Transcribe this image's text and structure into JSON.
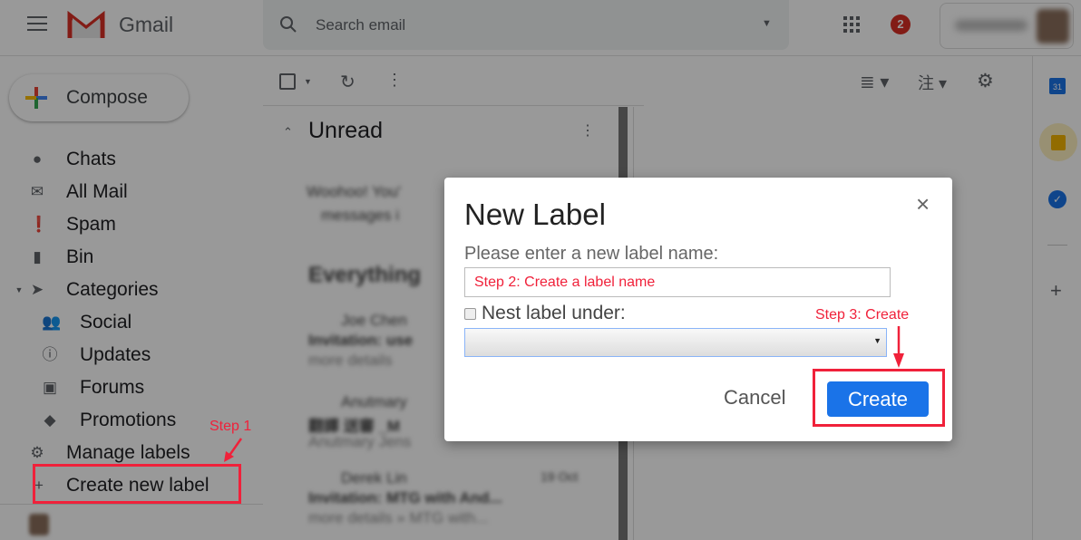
{
  "header": {
    "brand": "Gmail",
    "search_placeholder": "Search email",
    "notification_count": "2"
  },
  "sidebar": {
    "compose_label": "Compose",
    "items": [
      {
        "label": "Chats",
        "icon": "chat-icon"
      },
      {
        "label": "All Mail",
        "icon": "mail-icon"
      },
      {
        "label": "Spam",
        "icon": "spam-icon"
      },
      {
        "label": "Bin",
        "icon": "trash-icon"
      },
      {
        "label": "Categories",
        "icon": "label-icon"
      },
      {
        "label": "Social",
        "icon": "people-icon"
      },
      {
        "label": "Updates",
        "icon": "info-icon"
      },
      {
        "label": "Forums",
        "icon": "forum-icon"
      },
      {
        "label": "Promotions",
        "icon": "tag-icon"
      },
      {
        "label": "Manage labels",
        "icon": "gear-icon"
      },
      {
        "label": "Create new label",
        "icon": "plus-icon"
      }
    ]
  },
  "list": {
    "section_unread": "Unread",
    "unread_blurred": [
      "Woohoo! You'",
      "messages i"
    ],
    "section_everything": "Everything",
    "emails": [
      {
        "sender": "Joe Chen",
        "subject": "Invitation: use",
        "snippet": "more details"
      },
      {
        "sender": "Anutmary",
        "subject": "翻譯 送審 _M",
        "snippet": "Anutmary Jens"
      },
      {
        "sender": "Derek Lin",
        "date": "19 Oct",
        "subject": "Invitation: MTG with And...",
        "snippet": "more details » MTG with..."
      }
    ]
  },
  "dialog": {
    "title": "New Label",
    "name_prompt": "Please enter a new label name:",
    "name_value": "Step 2: Create a label name",
    "nest_label": "Nest label under:",
    "nest_checked": false,
    "nest_value": "",
    "cancel_label": "Cancel",
    "create_label": "Create",
    "close_icon": "close-icon"
  },
  "annotations": {
    "step1": "Step 1",
    "step3": "Step 3: Create",
    "color": "#f0213a"
  },
  "colors": {
    "primary": "#1a73e8",
    "badge": "#d93025"
  }
}
